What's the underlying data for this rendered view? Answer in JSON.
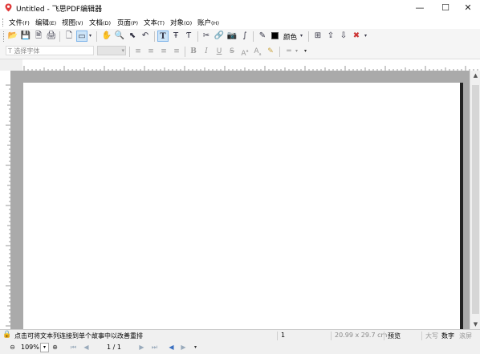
{
  "window": {
    "title": "Untitled - 飞思PDF编辑器",
    "minimize": "—",
    "maximize": "☐",
    "close": "✕"
  },
  "menu": [
    {
      "label": "文件",
      "accel": "(F)"
    },
    {
      "label": "编辑",
      "accel": "(E)"
    },
    {
      "label": "视图",
      "accel": "(V)"
    },
    {
      "label": "文档",
      "accel": "(D)"
    },
    {
      "label": "页面",
      "accel": "(P)"
    },
    {
      "label": "文本",
      "accel": "(T)"
    },
    {
      "label": "对象",
      "accel": "(O)"
    },
    {
      "label": "账户",
      "accel": "(H)"
    }
  ],
  "toolbar1": {
    "open": "📂",
    "save": "💾",
    "save_as": "🗎",
    "print": "🖨",
    "page": "🗋",
    "page_view": "▭",
    "hand": "✋",
    "zoom": "🔍",
    "select": "⬉",
    "undo": "↶",
    "text_tool": "T",
    "text_box": "Ŧ",
    "text_vert": "Ƭ",
    "crop": "✂",
    "link": "🔗",
    "camera": "📷",
    "shape": "∫",
    "eyedropper": "✎",
    "color_label": "颜色",
    "pg_insert": "⊞",
    "pg_extract": "⇪",
    "pg_export": "⇩",
    "pg_delete": "✖"
  },
  "toolbar2": {
    "font_placeholder": "选择字体",
    "align_left": "≡",
    "align_center": "≡",
    "align_right": "≡",
    "justify": "≡",
    "bold": "B",
    "italic": "I",
    "underline": "U",
    "strike": "S",
    "superscript": "A",
    "subscript": "A",
    "highlight": "✎",
    "line_style": "═"
  },
  "status": {
    "hint": "点击可将文本列连接到单个故事中以改善重排",
    "page_number": "1",
    "page_size": "20.99 x 29.7 cm",
    "preview": "预览",
    "caps": "大写",
    "num": "数字",
    "scroll": "滚屏"
  },
  "nav": {
    "zoom": "109%",
    "page_indicator": "1 / 1"
  },
  "icons": {
    "app": "pdf-app-icon",
    "lock": "lock-icon"
  },
  "colors": {
    "accent": "#7eb4ea",
    "canvas": "#aaaaaa",
    "page": "#ffffff"
  }
}
